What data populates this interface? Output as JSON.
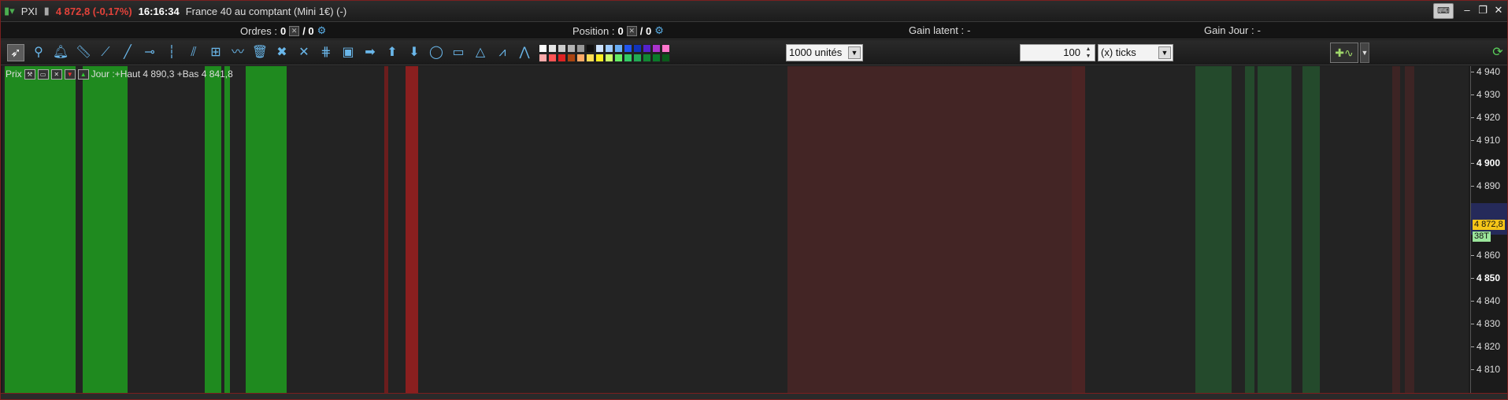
{
  "titlebar": {
    "ticker": "PXI",
    "price_change": "4 872,8 (-0,17%)",
    "time": "16:16:34",
    "instrument": "France 40 au comptant (Mini 1€) (-)"
  },
  "infobar": {
    "orders_label": "Ordres :",
    "orders_value": "0",
    "orders_total": "/ 0",
    "position_label": "Position :",
    "position_value": "0",
    "position_total": "/ 0",
    "gain_latent_label": "Gain latent :",
    "gain_latent_value": "-",
    "gain_jour_label": "Gain Jour :",
    "gain_jour_value": "-"
  },
  "toolbar": {
    "units_select": "1000 unités",
    "ticks_value": "100",
    "ticks_select": "(x) ticks",
    "palette": [
      "#ffffff",
      "#e6e6e6",
      "#cccccc",
      "#b3b3b3",
      "#999999",
      "#111111",
      "#cfe4ff",
      "#9ecbff",
      "#6aaef5",
      "#2255ee",
      "#1133bb",
      "#5522cc",
      "#aa33cc",
      "#ff77cc",
      "#ffaaaa",
      "#ff5555",
      "#dd2222",
      "#aa4411",
      "#ffaa66",
      "#ffdd55",
      "#ffee22",
      "#ccff66",
      "#66ee66",
      "#33cc66",
      "#22aa55",
      "#118833",
      "#0a7a2a",
      "#0a5a1a"
    ]
  },
  "chart": {
    "legend_label": "Prix",
    "legend_text": "Jour :+Haut 4 890,3 +Bas 4 841,8"
  },
  "axis": {
    "ticks": [
      {
        "label": "4 940",
        "major": false
      },
      {
        "label": "4 930",
        "major": false
      },
      {
        "label": "4 920",
        "major": false
      },
      {
        "label": "4 910",
        "major": false
      },
      {
        "label": "4 900",
        "major": true
      },
      {
        "label": "4 890",
        "major": false
      },
      {
        "label": "4 860",
        "major": false
      },
      {
        "label": "4 850",
        "major": true
      },
      {
        "label": "4 840",
        "major": false
      },
      {
        "label": "4 830",
        "major": false
      },
      {
        "label": "4 820",
        "major": false
      },
      {
        "label": "4 810",
        "major": false
      }
    ],
    "price_marker": "4 872,8",
    "timer_marker": "38T",
    "colors": {
      "price": "#f5c518",
      "timer": "#9be59b",
      "low": "#3b45d6"
    }
  },
  "colors": {
    "bg": "#232323",
    "green": "#1f8a1f",
    "dark_green": "#244a2c",
    "red": "#8a1f1f",
    "dark_red": "#432525"
  }
}
